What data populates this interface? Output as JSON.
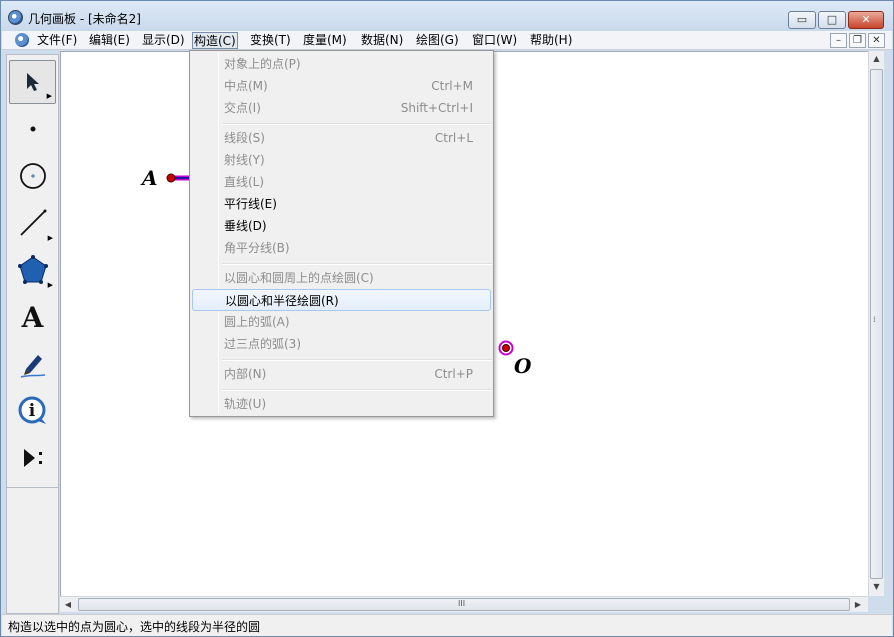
{
  "window": {
    "title": "几何画板 - [未命名2]",
    "controls": {
      "minimize": "▭",
      "maximize": "□",
      "close": "✕"
    }
  },
  "menubar": {
    "items": [
      {
        "label": "文件(F)"
      },
      {
        "label": "编辑(E)"
      },
      {
        "label": "显示(D)"
      },
      {
        "label": "构造(C)",
        "active": true
      },
      {
        "label": "变换(T)"
      },
      {
        "label": "度量(M)"
      },
      {
        "label": "数据(N)"
      },
      {
        "label": "绘图(G)"
      },
      {
        "label": "窗口(W)"
      },
      {
        "label": "帮助(H)"
      }
    ],
    "mdi": {
      "minimize": "–",
      "restore": "❐",
      "close": "✕"
    }
  },
  "toolbox": {
    "tools": [
      {
        "name": "arrow-tool-icon",
        "selected": true,
        "has_sub": true
      },
      {
        "name": "point-tool-icon",
        "selected": false,
        "has_sub": false
      },
      {
        "name": "compass-tool-icon",
        "selected": false,
        "has_sub": false
      },
      {
        "name": "straightedge-tool-icon",
        "selected": false,
        "has_sub": true
      },
      {
        "name": "polygon-tool-icon",
        "selected": false,
        "has_sub": true
      },
      {
        "name": "text-tool-icon",
        "glyph": "A",
        "selected": false,
        "has_sub": false
      },
      {
        "name": "marker-tool-icon",
        "selected": false,
        "has_sub": false
      },
      {
        "name": "information-tool-icon",
        "glyph": "i",
        "selected": false,
        "has_sub": false
      },
      {
        "name": "custom-tool-icon",
        "selected": false,
        "has_sub": false
      }
    ]
  },
  "canvas": {
    "points": [
      {
        "label": "A",
        "color": "#cc0000"
      },
      {
        "label": "O",
        "color": "#cc0000"
      }
    ],
    "segment_color": "#1a1aa8",
    "selection_color": "#cc00cc"
  },
  "dropdown": {
    "items": [
      {
        "label": "对象上的点(P)",
        "accel": "",
        "enabled": false
      },
      {
        "label": "中点(M)",
        "accel": "Ctrl+M",
        "enabled": false
      },
      {
        "label": "交点(I)",
        "accel": "Shift+Ctrl+I",
        "enabled": false
      },
      {
        "separator": true
      },
      {
        "label": "线段(S)",
        "accel": "Ctrl+L",
        "enabled": false
      },
      {
        "label": "射线(Y)",
        "accel": "",
        "enabled": false
      },
      {
        "label": "直线(L)",
        "accel": "",
        "enabled": false
      },
      {
        "label": "平行线(E)",
        "accel": "",
        "enabled": true
      },
      {
        "label": "垂线(D)",
        "accel": "",
        "enabled": true
      },
      {
        "label": "角平分线(B)",
        "accel": "",
        "enabled": false
      },
      {
        "separator": true
      },
      {
        "label": "以圆心和圆周上的点绘圆(C)",
        "accel": "",
        "enabled": false
      },
      {
        "label": "以圆心和半径绘圆(R)",
        "accel": "",
        "enabled": true,
        "highlighted": true
      },
      {
        "label": "圆上的弧(A)",
        "accel": "",
        "enabled": false
      },
      {
        "label": "过三点的弧(3)",
        "accel": "",
        "enabled": false
      },
      {
        "separator": true
      },
      {
        "label": "内部(N)",
        "accel": "Ctrl+P",
        "enabled": false
      },
      {
        "separator": true
      },
      {
        "label": "轨迹(U)",
        "accel": "",
        "enabled": false
      }
    ]
  },
  "scrollbars": {
    "grip": "⁞",
    "hgrip": "III"
  },
  "status": {
    "text": "构造以选中的点为圆心，选中的线段为半径的圆"
  }
}
